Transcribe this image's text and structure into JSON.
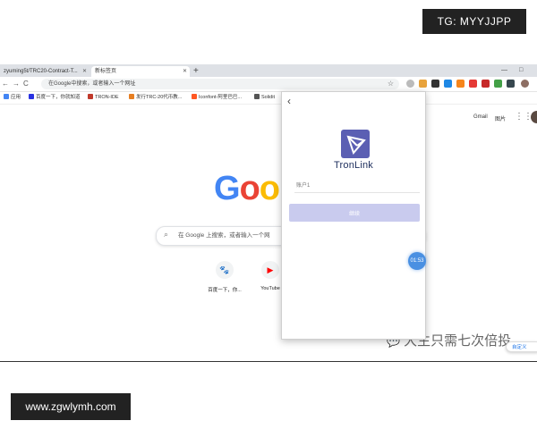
{
  "watermarks": {
    "top": "TG: MYYJJPP",
    "bottom": "www.zgwlymh.com",
    "wechat": "大生只需七次倍投"
  },
  "tabs": [
    {
      "label": "zyuming5t/TRC20-Contract-T...",
      "active": false
    },
    {
      "label": "新标签页",
      "active": true
    }
  ],
  "toolbar": {
    "back": "←",
    "forward": "→",
    "reload": "C",
    "omnibox_placeholder": "在Google中搜索，或者输入一个网址",
    "star": "☆"
  },
  "bookmarks": [
    {
      "label": "应用",
      "color": "#4285f4"
    },
    {
      "label": "百度一下，你就知道",
      "color": "#2932e1"
    },
    {
      "label": "TRON-IDE",
      "color": "#c0392b"
    },
    {
      "label": "发行TRC-20代币教...",
      "color": "#e67e22"
    },
    {
      "label": "Iconfont-阿里巴巴...",
      "color": "#ff5722"
    },
    {
      "label": "Solidit",
      "color": "#555555"
    }
  ],
  "header": {
    "gmail": "Gmail",
    "images": "图片",
    "apps_icon": "apps-grid-icon"
  },
  "google": {
    "logo_letters": [
      {
        "ch": "G",
        "color": "#4285f4"
      },
      {
        "ch": "o",
        "color": "#ea4335"
      },
      {
        "ch": "o",
        "color": "#fbbc05"
      }
    ],
    "search_placeholder": "在 Google 上搜索，或者输入一个网"
  },
  "shortcuts": [
    {
      "label": "百度一下，你...",
      "icon": "🐾",
      "color": "#2932e1"
    },
    {
      "label": "YouTube",
      "icon": "▶",
      "color": "#ff0000"
    }
  ],
  "tronlink": {
    "name": "TronLink",
    "password_placeholder": "账户1",
    "submit_label": "继续",
    "timer": "01:53"
  },
  "partial_button": "自定义"
}
